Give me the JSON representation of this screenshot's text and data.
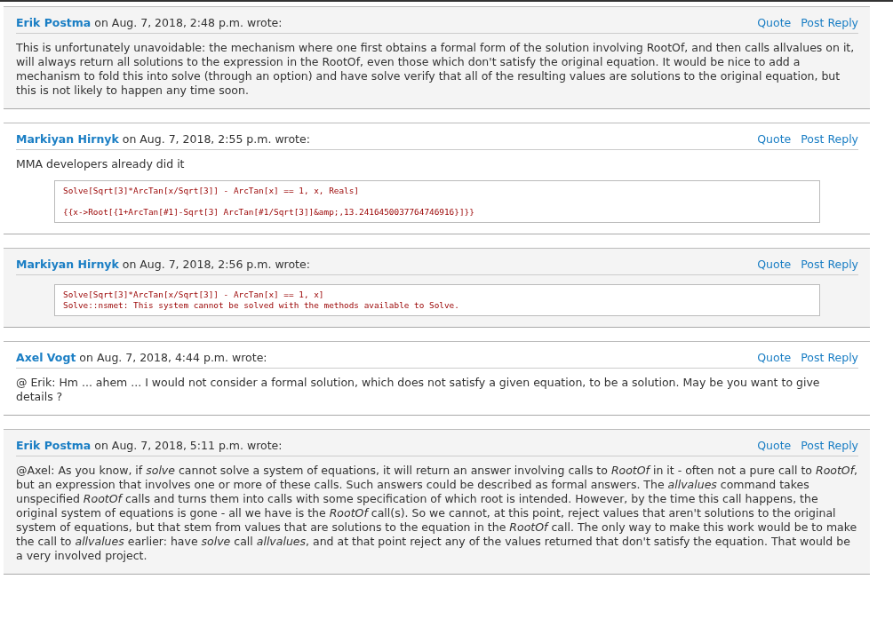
{
  "posts": [
    {
      "author": "Erik Postma",
      "meta": "on Aug. 7, 2018, 2:48 p.m. wrote:",
      "actions": [
        "Quote",
        "Post Reply"
      ],
      "body": [
        "This is unfortunately unavoidable: the mechanism where one first obtains a formal form of the solution involving RootOf, and then calls allvalues on it, will always return all solutions to the expression in the RootOf, even those which don't satisfy the original equation. It would be nice to add a mechanism to fold this into solve (through an option) and have solve verify that all of the resulting values are solutions to the original equation, but this is not likely to happen any time soon."
      ]
    },
    {
      "author": "Markiyan Hirnyk",
      "meta": "on Aug. 7, 2018, 2:55 p.m. wrote:",
      "actions": [
        "Quote",
        "Post Reply"
      ],
      "body": [
        "MMA developers already did it"
      ],
      "code": [
        [
          "Solve[Sqrt[3]*ArcTan[x/Sqrt[3]] - ArcTan[x] == 1, x, Reals]"
        ],
        [
          "{{x->Root[{1+ArcTan[#1]-Sqrt[3] ArcTan[#1/Sqrt[3]]&amp;,13.2416450037764746916}]}}"
        ]
      ]
    },
    {
      "author": "Markiyan Hirnyk",
      "meta": "on Aug. 7, 2018, 2:56 p.m. wrote:",
      "actions": [
        "Quote",
        "Post Reply"
      ],
      "code": [
        [
          "Solve[Sqrt[3]*ArcTan[x/Sqrt[3]] - ArcTan[x] == 1, x]",
          "Solve::nsmet: This system cannot be solved with the methods available to Solve."
        ]
      ]
    },
    {
      "author": "Axel Vogt",
      "meta": "on Aug. 7, 2018, 4:44 p.m. wrote:",
      "actions": [
        "Quote",
        "Post Reply"
      ],
      "body": [
        "@ Erik: Hm ... ahem ... I would not consider a formal solution, which does not satisfy a given equation, to be a solution. May be you want to give details ?"
      ]
    },
    {
      "author": "Erik Postma",
      "meta": "on Aug. 7, 2018, 5:11 p.m. wrote:",
      "actions": [
        "Quote",
        "Post Reply"
      ],
      "body": [
        "@Axel: As you know, if *solve* cannot solve a system of equations, it will return an answer involving calls to *RootOf* in it - often not a pure call to *RootOf*, but an expression that involves one or more of these calls. Such answers could be described as formal answers. The *allvalues* command takes unspecified *RootOf* calls and turns them into calls with some specification of which root is intended. However, by the time this call happens, the original system of equations is gone - all we have is the *RootOf* call(s). So we cannot, at this point, reject values that aren't solutions to the original system of equations, but that stem from values that are solutions to the equation in the *RootOf* call. The only way to make this work would be to make the call to *allvalues* earlier: have *solve* call *allvalues*, and at that point reject any of the values returned that don't satisfy the equation. That would be a very involved project."
      ]
    }
  ]
}
